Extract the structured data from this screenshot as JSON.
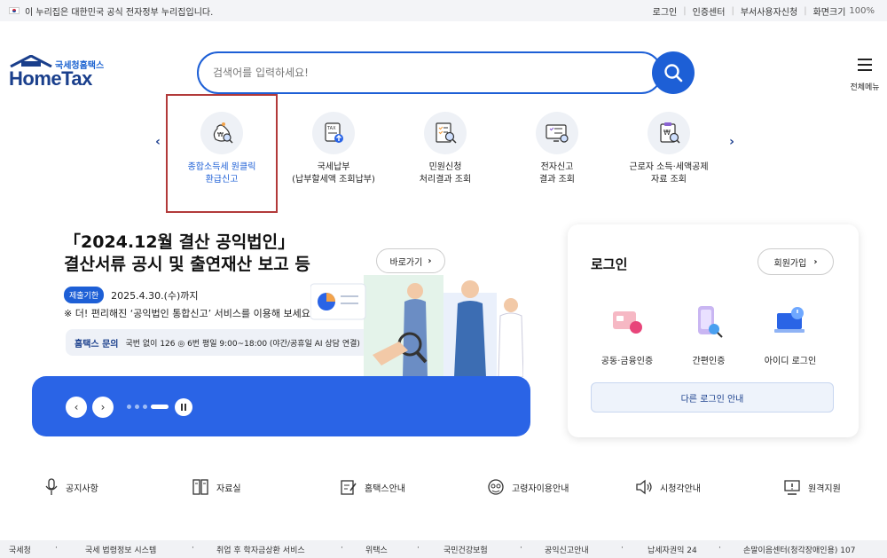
{
  "topbar": {
    "notice": "이 누리집은 대한민국 공식 전자정부 누리집입니다.",
    "links": [
      "로그인",
      "인증센터",
      "부서사용자신청"
    ],
    "zoom_label": "화면크기",
    "zoom_value": "100%"
  },
  "header": {
    "logo_sub": "국세청홈택스",
    "logo_main": "HomeTax",
    "search_placeholder": "검색어를 입력하세요!",
    "menu_label": "전체메뉴"
  },
  "quick_menu": [
    {
      "label1": "종합소득세 원클릭",
      "label2": "환급신고",
      "icon": "money-bag-search-icon",
      "highlighted": true
    },
    {
      "label1": "국세납부",
      "label2": "(납부할세액 조회납부)",
      "icon": "tax-document-upload-icon",
      "highlighted": false
    },
    {
      "label1": "민원신청",
      "label2": "처리결과 조회",
      "icon": "checklist-search-icon",
      "highlighted": false
    },
    {
      "label1": "전자신고",
      "label2": "결과 조회",
      "icon": "monitor-checklist-icon",
      "highlighted": false
    },
    {
      "label1": "근로자 소득·세액공제",
      "label2": "자료 조회",
      "icon": "clipboard-won-search-icon",
      "highlighted": false
    }
  ],
  "banner": {
    "title1": "「2024.12월 결산 공익법인」",
    "title2": "결산서류 공시 및 출연재산 보고 등",
    "go_label": "바로가기",
    "deadline_badge": "제출기한",
    "deadline": "2025.4.30.(수)까지",
    "note": "※ 더! 편리해진 ‘공익법인 통합신고’ 서비스를 이용해 보세요!",
    "contact_label": "홈택스 문의",
    "contact_text": "국번 없이 126 ◎ 6번 평일 9:00~18:00 (야간/공휴일 AI 상담 연결)",
    "slide_count": 4,
    "active_slide": 4
  },
  "login": {
    "title": "로그인",
    "join_label": "회원가입",
    "options": [
      "공동·금융인증",
      "간편인증",
      "아이디 로그인"
    ],
    "other_label": "다른 로그인 안내"
  },
  "quick_links": [
    "공지사항",
    "자료실",
    "홈택스안내",
    "고령자이용안내",
    "시청각안내",
    "원격지원"
  ],
  "footer": [
    "국세청",
    "국세 법령정보 시스템",
    "취업 후 학자금상환 서비스",
    "위택스",
    "국민건강보험",
    "공익신고안내",
    "납세자권익 24",
    "손말이음센터(청각장애인용) 107"
  ],
  "colors": {
    "brand": "#1d5fd6",
    "banner_bar": "#2a64e6",
    "highlight_border": "#b23a3a",
    "logo_navy": "#1a3f8c"
  }
}
